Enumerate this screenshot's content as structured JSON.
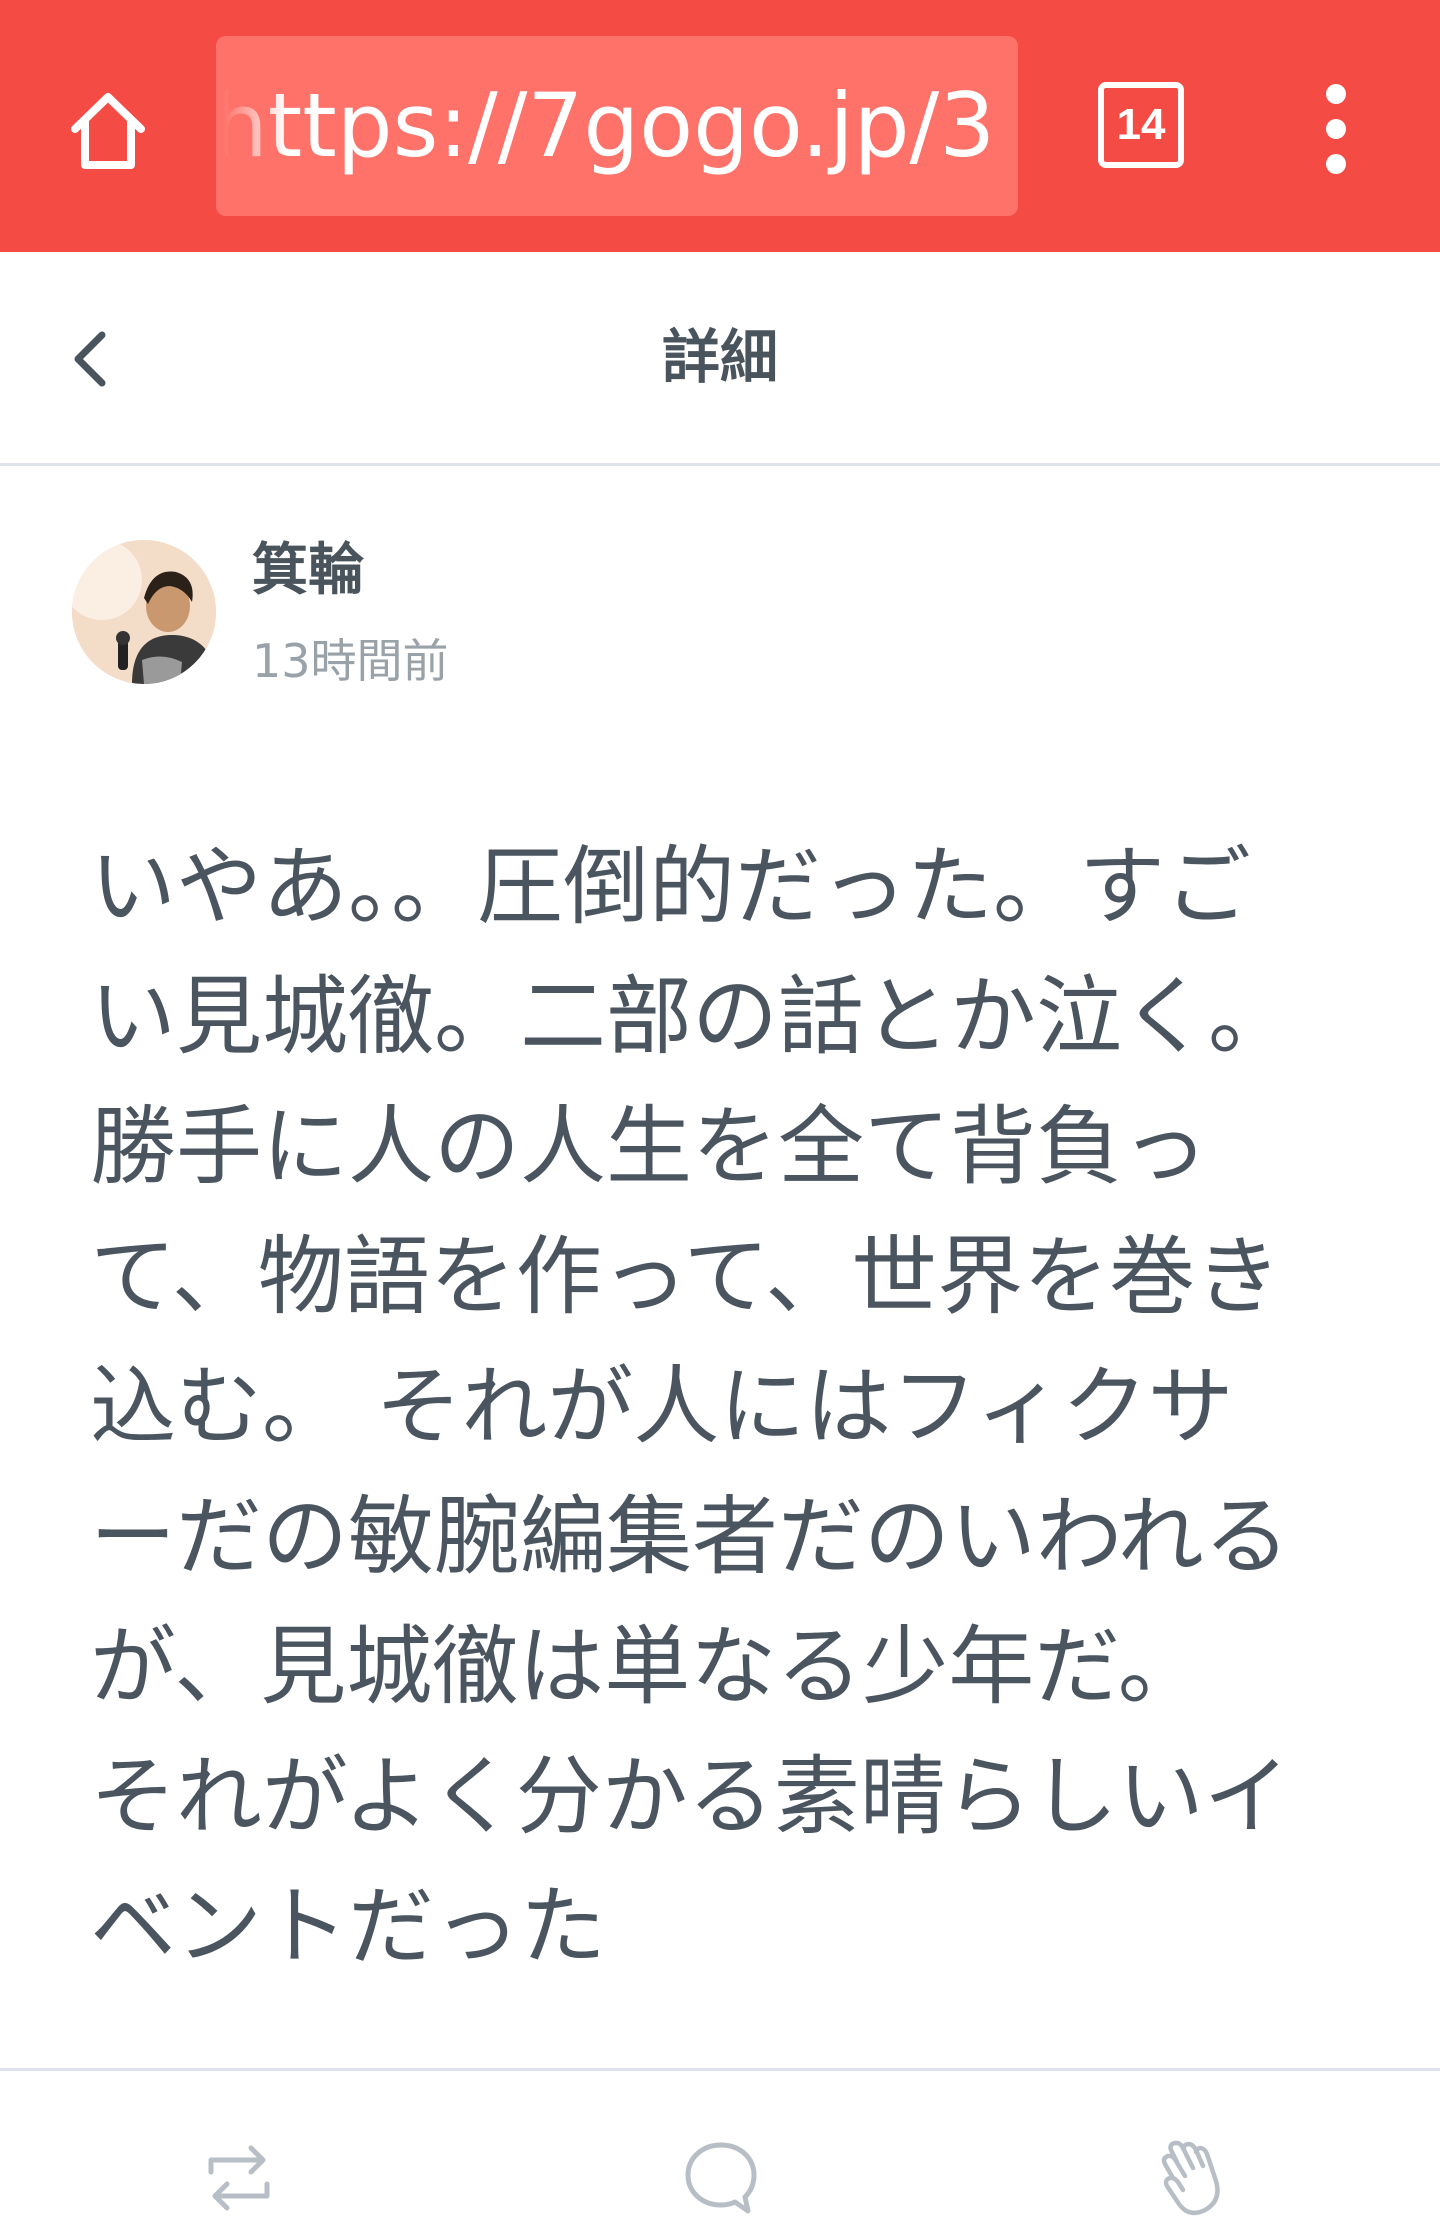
{
  "browser": {
    "url": "https://7gogo.jp/3",
    "tab_count": "14",
    "home_icon": "home-icon",
    "menu_icon": "overflow-menu-icon",
    "bar_color": "#f44b44"
  },
  "header": {
    "title": "詳細",
    "back_icon": "chevron-left-icon"
  },
  "post": {
    "author": "箕輪",
    "time": "13時間前",
    "lines": [
      "いやあ。。圧倒的だった。すご",
      "い見城徹。二部の話とか泣く。",
      "勝手に人の人生を全て背負っ",
      "て、物語を作って、世界を巻き",
      "込む。 それが人にはフィクサ",
      "ーだの敏腕編集者だのいわれる",
      "が、見城徹は単なる少年だ。",
      "それがよく分かる素晴らしいイ",
      "ベントだった"
    ]
  },
  "actions": {
    "items": [
      "repost-icon",
      "comment-icon",
      "clap-icon"
    ]
  }
}
